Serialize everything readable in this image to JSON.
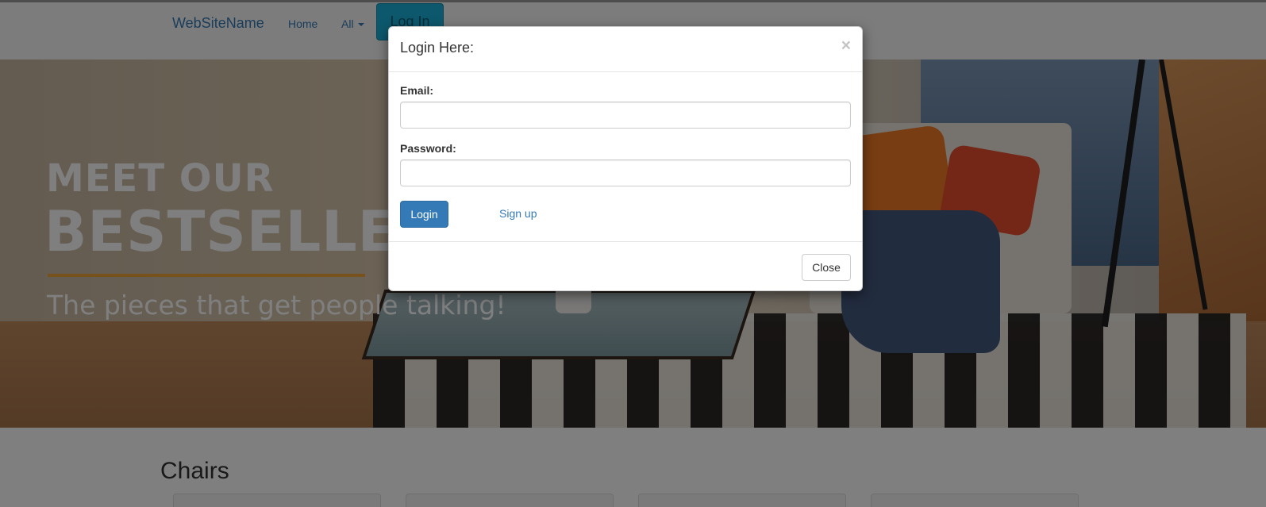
{
  "navbar": {
    "brand": "WebSiteName",
    "home_label": "Home",
    "all_label": "All",
    "login_label": "Log In"
  },
  "hero": {
    "title_line1": "MEET OUR",
    "title_line2": "BESTSELLERS",
    "tagline": "The pieces that get people talking!"
  },
  "section": {
    "title": "Chairs"
  },
  "modal": {
    "title": "Login Here:",
    "close_x": "×",
    "email_label": "Email:",
    "email_value": "",
    "password_label": "Password:",
    "password_value": "",
    "login_button": "Login",
    "signup_link": "Sign up",
    "close_button": "Close"
  },
  "colors": {
    "primary": "#337ab7",
    "navbar_login_bg": "#1ab0d8",
    "accent_rule": "#f0a43a"
  },
  "icons": {
    "dropdown": "caret-down-icon",
    "close": "close-icon"
  }
}
